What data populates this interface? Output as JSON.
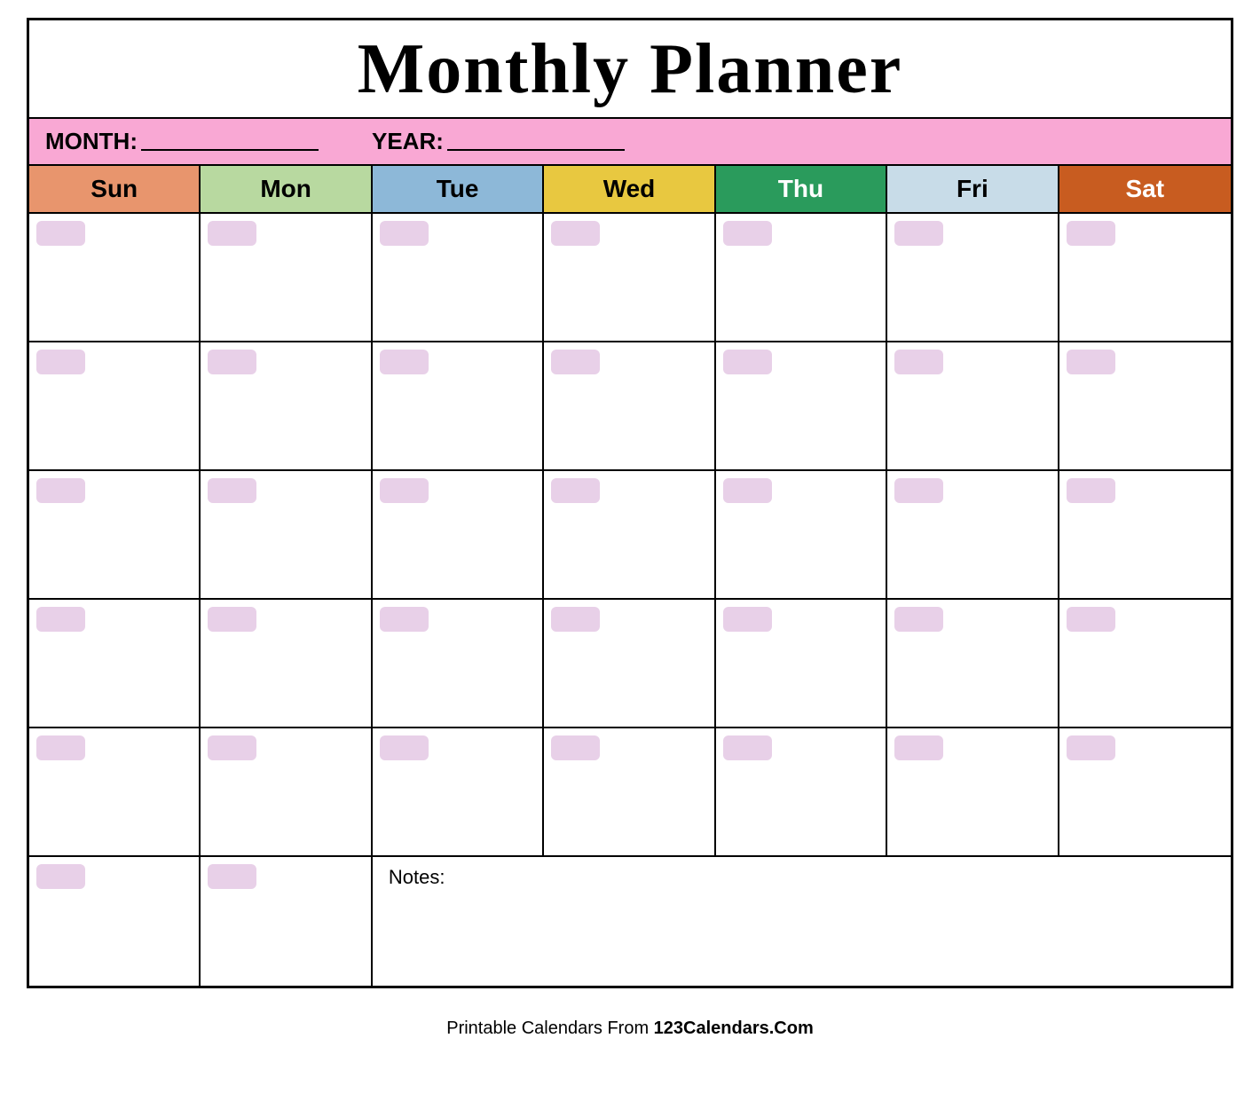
{
  "title": "Monthly Planner",
  "month_label": "MONTH:",
  "year_label": "YEAR:",
  "days": [
    {
      "key": "sun",
      "label": "Sun",
      "class": "day-sun"
    },
    {
      "key": "mon",
      "label": "Mon",
      "class": "day-mon"
    },
    {
      "key": "tue",
      "label": "Tue",
      "class": "day-tue"
    },
    {
      "key": "wed",
      "label": "Wed",
      "class": "day-wed"
    },
    {
      "key": "thu",
      "label": "Thu",
      "class": "day-thu"
    },
    {
      "key": "fri",
      "label": "Fri",
      "class": "day-fri"
    },
    {
      "key": "sat",
      "label": "Sat",
      "class": "day-sat"
    }
  ],
  "rows": 5,
  "notes_label": "Notes:",
  "footer_text": "Printable Calendars From ",
  "footer_brand": "123Calendars.Com"
}
